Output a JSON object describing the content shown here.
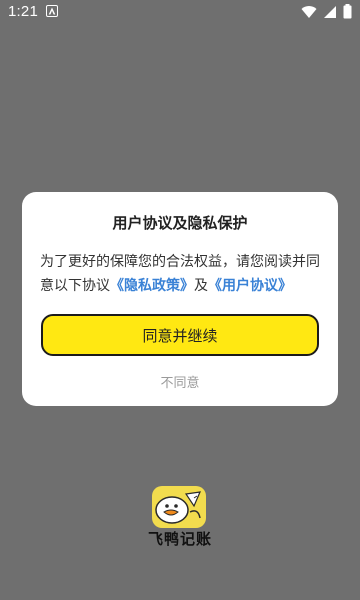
{
  "status_bar": {
    "time": "1:21",
    "icons": [
      "notification-a-icon",
      "wifi-icon",
      "signal-icon",
      "battery-icon"
    ]
  },
  "dialog": {
    "title": "用户协议及隐私保护",
    "body_prefix": "为了更好的保障您的合法权益，请您阅读并同意以下协议",
    "privacy_link": "《隐私政策》",
    "connector": "及",
    "terms_link": "《用户协议》",
    "agree_label": "同意并继续",
    "disagree_label": "不同意"
  },
  "app": {
    "name": "飞鸭记账",
    "logo_icon": "duck-logo-icon"
  },
  "colors": {
    "overlay": "#6f6f6f",
    "accent_yellow": "#ffe812",
    "link_blue": "#3a82d6"
  }
}
